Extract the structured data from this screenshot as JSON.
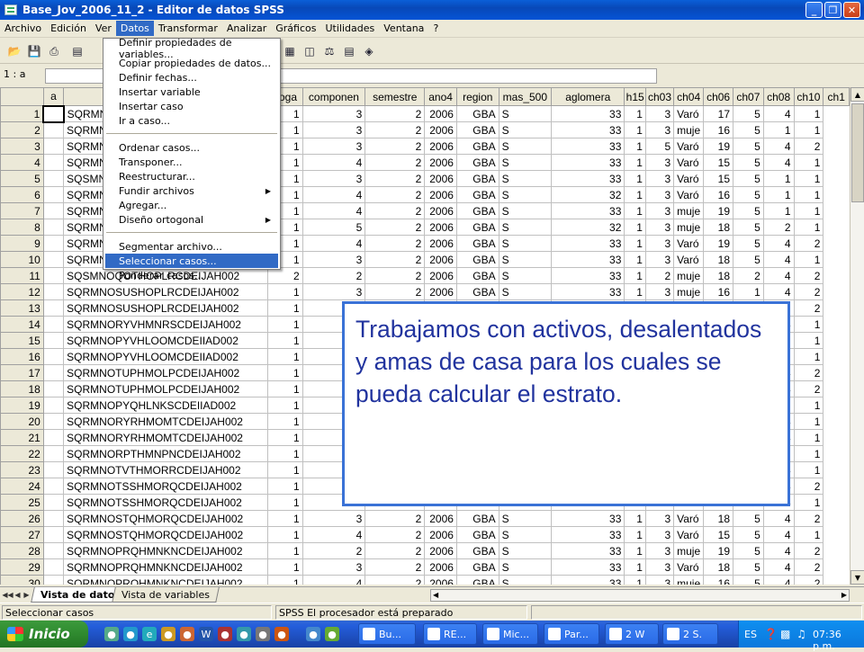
{
  "window": {
    "title": "Base_Jov_2006_11_2 - Editor de datos SPSS",
    "minimize": "_",
    "maximize": "❐",
    "close": "✕"
  },
  "menubar": [
    "Archivo",
    "Edición",
    "Ver",
    "Datos",
    "Transformar",
    "Analizar",
    "Gráficos",
    "Utilidades",
    "Ventana",
    "?"
  ],
  "active_menu": "Datos",
  "cellbar": {
    "ref": "1 : a",
    "value": ""
  },
  "data_menu": {
    "groups": [
      [
        "Definir propiedades de variables...",
        "Copiar propiedades de datos...",
        "Definir fechas...",
        "Insertar variable",
        "Insertar caso",
        "Ir a caso..."
      ],
      [
        "Ordenar casos...",
        "Transponer...",
        "Reestructurar...",
        "Fundir archivos",
        "Agregar...",
        "Diseño ortogonal"
      ],
      [
        "Segmentar archivo...",
        "Seleccionar casos...",
        "Ponderar casos..."
      ]
    ],
    "submenus": [
      "Fundir archivos",
      "Diseño ortogonal"
    ],
    "highlighted": "Seleccionar casos..."
  },
  "grid": {
    "columns": [
      "a",
      "",
      "hoga",
      "componen",
      "semestre",
      "ano4",
      "region",
      "mas_500",
      "aglomera",
      "h15",
      "ch03",
      "ch04",
      "ch06",
      "ch07",
      "ch08",
      "ch10",
      "ch1"
    ],
    "rows": [
      [
        1,
        "",
        "SQRMNORPQHLKNDEIIAD002",
        "1",
        "3",
        "2",
        "2006",
        "GBA",
        "S",
        "33",
        "1",
        "3",
        "Varó",
        "17",
        "5",
        "4",
        "1"
      ],
      [
        2,
        "",
        "SQRMNORPQHLKNDEIIAD002",
        "1",
        "3",
        "2",
        "2006",
        "GBA",
        "S",
        "33",
        "1",
        "3",
        "muje",
        "16",
        "5",
        "1",
        "1"
      ],
      [
        3,
        "",
        "SQRMNORPQHLKNDEIIAD002",
        "1",
        "3",
        "2",
        "2006",
        "GBA",
        "S",
        "33",
        "1",
        "5",
        "Varó",
        "19",
        "5",
        "4",
        "2"
      ],
      [
        4,
        "",
        "SQRMNORPQHLKNDEIIAD002",
        "1",
        "4",
        "2",
        "2006",
        "GBA",
        "S",
        "33",
        "1",
        "3",
        "Varó",
        "15",
        "5",
        "4",
        "1"
      ],
      [
        5,
        "",
        "SQSMNOQOTHOPLRCDEIJAH002",
        "1",
        "3",
        "2",
        "2006",
        "GBA",
        "S",
        "33",
        "1",
        "3",
        "Varó",
        "15",
        "5",
        "1",
        "1"
      ],
      [
        6,
        "",
        "SQRMNOTUPHMOLPCDEIJAH002",
        "1",
        "4",
        "2",
        "2006",
        "GBA",
        "S",
        "32",
        "1",
        "3",
        "Varó",
        "16",
        "5",
        "1",
        "1"
      ],
      [
        7,
        "",
        "SQRMNOTUPHMOLPCDEIJAH002",
        "1",
        "4",
        "2",
        "2006",
        "GBA",
        "S",
        "33",
        "1",
        "3",
        "muje",
        "19",
        "5",
        "1",
        "1"
      ],
      [
        8,
        "",
        "SQRMNORYHRMOMTCDEIJAH002",
        "1",
        "5",
        "2",
        "2006",
        "GBA",
        "S",
        "32",
        "1",
        "3",
        "muje",
        "18",
        "5",
        "2",
        "1"
      ],
      [
        9,
        "",
        "SQRMNORYHRMOMTCDEIJAH002",
        "1",
        "4",
        "2",
        "2006",
        "GBA",
        "S",
        "33",
        "1",
        "3",
        "Varó",
        "19",
        "5",
        "4",
        "2"
      ],
      [
        10,
        "",
        "SQRMNOPRQHMNKNCDEIJAH002",
        "1",
        "3",
        "2",
        "2006",
        "GBA",
        "S",
        "33",
        "1",
        "3",
        "Varó",
        "18",
        "5",
        "4",
        "1"
      ],
      [
        11,
        "",
        "SQSMNOQOTHOPLRCDEIJAH002",
        "2",
        "2",
        "2",
        "2006",
        "GBA",
        "S",
        "33",
        "1",
        "2",
        "muje",
        "18",
        "2",
        "4",
        "2"
      ],
      [
        12,
        "",
        "SQRMNOSUSHOPLRCDEIJAH002",
        "1",
        "3",
        "2",
        "2006",
        "GBA",
        "S",
        "33",
        "1",
        "3",
        "muje",
        "16",
        "1",
        "4",
        "2"
      ],
      [
        13,
        "",
        "SQRMNOSUSHOPLRCDEIJAH002",
        "1",
        "",
        "",
        "",
        "",
        "",
        "",
        "",
        "",
        "",
        "",
        "",
        "1",
        "2"
      ],
      [
        14,
        "",
        "SQRMNORYVHMNRSCDEIJAH002",
        "1",
        "",
        "",
        "",
        "",
        "",
        "",
        "",
        "",
        "",
        "",
        "",
        "4",
        "1"
      ],
      [
        15,
        "",
        "SQRMNOPYVHLOOMCDEIIAD002",
        "1",
        "",
        "",
        "",
        "",
        "",
        "",
        "",
        "",
        "",
        "",
        "",
        "1",
        "1"
      ],
      [
        16,
        "",
        "SQRMNOPYVHLOOMCDEIIAD002",
        "1",
        "",
        "",
        "",
        "",
        "",
        "",
        "",
        "",
        "",
        "",
        "",
        "1",
        "1"
      ],
      [
        17,
        "",
        "SQRMNOTUPHMOLPCDEIJAH002",
        "1",
        "",
        "",
        "",
        "",
        "",
        "",
        "",
        "",
        "",
        "",
        "",
        "4",
        "2"
      ],
      [
        18,
        "",
        "SQRMNOTUPHMOLPCDEIJAH002",
        "1",
        "",
        "",
        "",
        "",
        "",
        "",
        "",
        "",
        "",
        "",
        "",
        "4",
        "2"
      ],
      [
        19,
        "",
        "SQRMNOPYQHLNKSCDEIIAD002",
        "1",
        "",
        "",
        "",
        "",
        "",
        "",
        "",
        "",
        "",
        "",
        "",
        "2",
        "1"
      ],
      [
        20,
        "",
        "SQRMNORYRHMOMTCDEIJAH002",
        "1",
        "",
        "",
        "",
        "",
        "",
        "",
        "",
        "",
        "",
        "",
        "",
        "4",
        "1"
      ],
      [
        21,
        "",
        "SQRMNORYRHMOMTCDEIJAH002",
        "1",
        "",
        "",
        "",
        "",
        "",
        "",
        "",
        "",
        "",
        "",
        "",
        "4",
        "1"
      ],
      [
        22,
        "",
        "SQRMNORPTHMNPNCDEIJAH002",
        "1",
        "",
        "",
        "",
        "",
        "",
        "",
        "",
        "",
        "",
        "",
        "",
        "1",
        "1"
      ],
      [
        23,
        "",
        "SQRMNOTVTHMORRCDEIJAH002",
        "1",
        "",
        "",
        "",
        "",
        "",
        "",
        "",
        "",
        "",
        "",
        "",
        "4",
        "1"
      ],
      [
        24,
        "",
        "SQRMNOTSSHMORQCDEIJAH002",
        "1",
        "",
        "",
        "",
        "",
        "",
        "",
        "",
        "",
        "",
        "",
        "",
        "4",
        "2"
      ],
      [
        25,
        "",
        "SQRMNOTSSHMORQCDEIJAH002",
        "1",
        "",
        "",
        "",
        "",
        "",
        "",
        "",
        "",
        "",
        "",
        "",
        "4",
        "1"
      ],
      [
        26,
        "",
        "SQRMNOSTQHMORQCDEIJAH002",
        "1",
        "3",
        "2",
        "2006",
        "GBA",
        "S",
        "33",
        "1",
        "3",
        "Varó",
        "18",
        "5",
        "4",
        "2"
      ],
      [
        27,
        "",
        "SQRMNOSTQHMORQCDEIJAH002",
        "1",
        "4",
        "2",
        "2006",
        "GBA",
        "S",
        "33",
        "1",
        "3",
        "Varó",
        "15",
        "5",
        "4",
        "1"
      ],
      [
        28,
        "",
        "SQRMNOPRQHMNKNCDEIJAH002",
        "1",
        "2",
        "2",
        "2006",
        "GBA",
        "S",
        "33",
        "1",
        "3",
        "muje",
        "19",
        "5",
        "4",
        "2"
      ],
      [
        29,
        "",
        "SQRMNOPRQHMNKNCDEIJAH002",
        "1",
        "3",
        "2",
        "2006",
        "GBA",
        "S",
        "33",
        "1",
        "3",
        "Varó",
        "18",
        "5",
        "4",
        "2"
      ],
      [
        30,
        "",
        "SQRMNOPRQHMNKNCDEIJAH002",
        "1",
        "4",
        "2",
        "2006",
        "GBA",
        "S",
        "33",
        "1",
        "3",
        "muje",
        "16",
        "5",
        "4",
        "2"
      ]
    ]
  },
  "tabs": {
    "data_view": "Vista de datos",
    "variable_view": "Vista de variables"
  },
  "status": {
    "left": "Seleccionar casos",
    "processor": "SPSS El procesador está preparado"
  },
  "callout": {
    "text": "Trabajamos con  activos, desalentados y amas de casa para los cuales se pueda calcular el estrato."
  },
  "taskbar": {
    "start": "Inicio",
    "tasks": [
      "Bu...",
      "RE...",
      "Mic...",
      "Par...",
      "2 W",
      "2 S."
    ],
    "lang": "ES",
    "clock": "07:36 p.m."
  }
}
